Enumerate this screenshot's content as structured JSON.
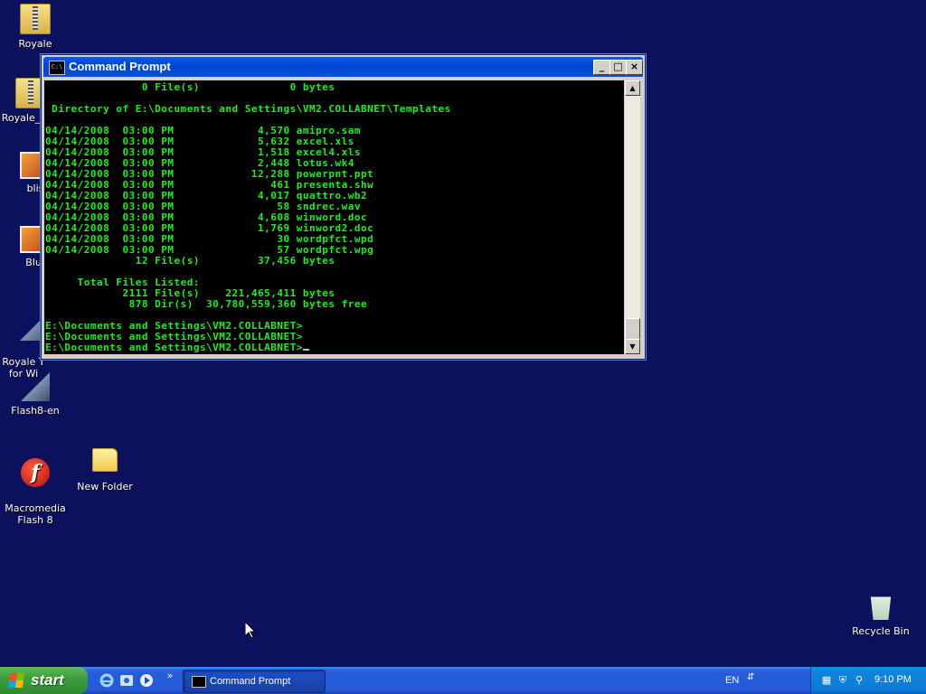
{
  "desktop_icons": [
    {
      "label": "Royale",
      "icon": "zip-folder-icon"
    },
    {
      "label": "Royale_",
      "icon": "zip-folder-icon"
    },
    {
      "label": "blis",
      "icon": "image-file-icon"
    },
    {
      "label": "Bluf",
      "icon": "image-file-icon"
    },
    {
      "label": "Royale T\nfor Wi",
      "icon": "flash-tool-icon"
    },
    {
      "label": "Flash8-en",
      "icon": "flash-tool-icon"
    },
    {
      "label": "Macromedia\nFlash 8",
      "icon": "flash-logo-icon"
    },
    {
      "label": "New Folder",
      "icon": "folder-icon"
    },
    {
      "label": "Recycle Bin",
      "icon": "recycle-bin-icon"
    }
  ],
  "window": {
    "title": "Command Prompt",
    "minimize": "_",
    "maximize": "□",
    "close": "×",
    "console_text": "               0 File(s)              0 bytes\n\n Directory of E:\\Documents and Settings\\VM2.COLLABNET\\Templates\n\n04/14/2008  03:00 PM             4,570 amipro.sam\n04/14/2008  03:00 PM             5,632 excel.xls\n04/14/2008  03:00 PM             1,518 excel4.xls\n04/14/2008  03:00 PM             2,448 lotus.wk4\n04/14/2008  03:00 PM            12,288 powerpnt.ppt\n04/14/2008  03:00 PM               461 presenta.shw\n04/14/2008  03:00 PM             4,017 quattro.wb2\n04/14/2008  03:00 PM                58 sndrec.wav\n04/14/2008  03:00 PM             4,608 winword.doc\n04/14/2008  03:00 PM             1,769 winword2.doc\n04/14/2008  03:00 PM                30 wordpfct.wpd\n04/14/2008  03:00 PM                57 wordpfct.wpg\n              12 File(s)         37,456 bytes\n\n     Total Files Listed:\n            2111 File(s)    221,465,411 bytes\n             878 Dir(s)  30,780,559,360 bytes free\n\nE:\\Documents and Settings\\VM2.COLLABNET>\nE:\\Documents and Settings\\VM2.COLLABNET>\nE:\\Documents and Settings\\VM2.COLLABNET>",
    "console_color": "#1df01d"
  },
  "taskbar": {
    "start_label": "start",
    "quick_launch": [
      "ie-icon",
      "outlook-icon",
      "media-player-icon"
    ],
    "chevron": "»",
    "task_item_label": "Command Prompt",
    "language": "EN",
    "clock": "9:10 PM"
  },
  "colors": {
    "desktop_bg": "#0b115c",
    "title_bar": "#0046d5",
    "start_green": "#3c9f3c"
  }
}
